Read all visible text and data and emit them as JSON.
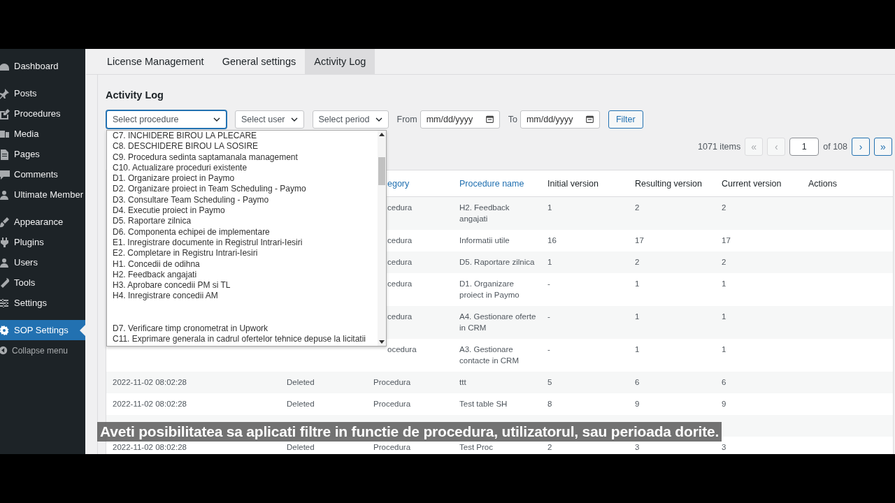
{
  "sidebar": {
    "items": [
      {
        "label": "Dashboard",
        "selected": false
      },
      {
        "label": "Posts",
        "selected": false
      },
      {
        "label": "Procedures",
        "selected": false
      },
      {
        "label": "Media",
        "selected": false
      },
      {
        "label": "Pages",
        "selected": false
      },
      {
        "label": "Comments",
        "selected": false
      },
      {
        "label": "Ultimate Member",
        "selected": false
      },
      {
        "label": "Appearance",
        "selected": false
      },
      {
        "label": "Plugins",
        "selected": false
      },
      {
        "label": "Users",
        "selected": false
      },
      {
        "label": "Tools",
        "selected": false
      },
      {
        "label": "Settings",
        "selected": false
      },
      {
        "label": "SOP Settings",
        "selected": true
      }
    ],
    "collapse": "Collapse menu"
  },
  "tabs": [
    {
      "label": "License Management",
      "selected": false
    },
    {
      "label": "General settings",
      "selected": false
    },
    {
      "label": "Activity Log",
      "selected": true
    }
  ],
  "heading": "Activity Log",
  "filters": {
    "procedure": {
      "placeholder": "Select procedure",
      "expanded": true
    },
    "user": "Select user",
    "period": "Select period",
    "from_label": "From",
    "from": {
      "placeholder": "mm/dd/yyyy"
    },
    "to_label": "To",
    "to": {
      "placeholder": "mm/dd/yyyy"
    },
    "button": "Filter"
  },
  "procedure_options": [
    "C7. INCHIDERE BIROU LA PLECARE",
    "C8. DESCHIDERE BIROU LA SOSIRE",
    "C9. Procedura sedinta saptamanala management",
    "C10. Actualizare proceduri existente",
    "D1. Organizare proiect in Paymo",
    "D2. Organizare proiect in Team Scheduling - Paymo",
    "D3. Consultare Team Scheduling - Paymo",
    "D4. Executie proiect in Paymo",
    "D5. Raportare zilnica",
    "D6. Componenta echipei de implementare",
    "E1. Inregistrare documente in Registrul Intrari-Iesiri",
    "E2. Completare in Registru Intrari-Iesiri",
    "H1. Concedii de odihna",
    "H2. Feedback angajati",
    "H3. Aprobare concedii PM si TL",
    "H4. Inregistrare concedii AM",
    "D7. Verificare timp cronometrat in Upwork",
    "C11. Exprimare generala in cadrul ofertelor tehnice depuse la licitatii"
  ],
  "pagination": {
    "count": "1071 items",
    "first": "«",
    "prev": "‹",
    "page": "1",
    "of": "of 108",
    "next": "›",
    "last": "»"
  },
  "table": {
    "columns": [
      "",
      "",
      "egory",
      "Procedure name",
      "Initial version",
      "Resulting version",
      "Current version",
      "Actions"
    ],
    "rows": [
      {
        "category": "cedura",
        "procedure": "H2. Feedback angajati",
        "initial": "1",
        "resulting": "2",
        "current": "2"
      },
      {
        "category": "cedura",
        "procedure": "Informatii utile",
        "initial": "16",
        "resulting": "17",
        "current": "17"
      },
      {
        "category": "cedura",
        "procedure": "D5. Raportare zilnica",
        "initial": "1",
        "resulting": "2",
        "current": "2"
      },
      {
        "category": "cedura",
        "procedure": "D1. Organizare proiect in Paymo",
        "initial": "-",
        "resulting": "1",
        "current": "1"
      },
      {
        "category": "cedura",
        "procedure": "A4. Gestionare oferte in CRM",
        "initial": "-",
        "resulting": "1",
        "current": "1"
      },
      {
        "category": "ocedura",
        "procedure": "A3. Gestionare contacte in CRM",
        "initial": "-",
        "resulting": "1",
        "current": "1"
      },
      {
        "date": "2022-11-02 08:02:28",
        "action": "Deleted",
        "category": "Procedura",
        "procedure": "ttt",
        "initial": "5",
        "resulting": "6",
        "current": "6"
      },
      {
        "date": "2022-11-02 08:02:28",
        "action": "Deleted",
        "category": "Procedura",
        "procedure": "Test table SH",
        "initial": "8",
        "resulting": "9",
        "current": "9"
      },
      {},
      {
        "date": "2022-11-02 08:02:28",
        "action": "Deleted",
        "category": "Procedura",
        "procedure": "Test Proc",
        "initial": "2",
        "resulting": "3",
        "current": "3"
      }
    ]
  },
  "caption": "Aveti posibilitatea sa aplicati filtre in functie de procedura, utilizatorul, sau perioada dorite."
}
